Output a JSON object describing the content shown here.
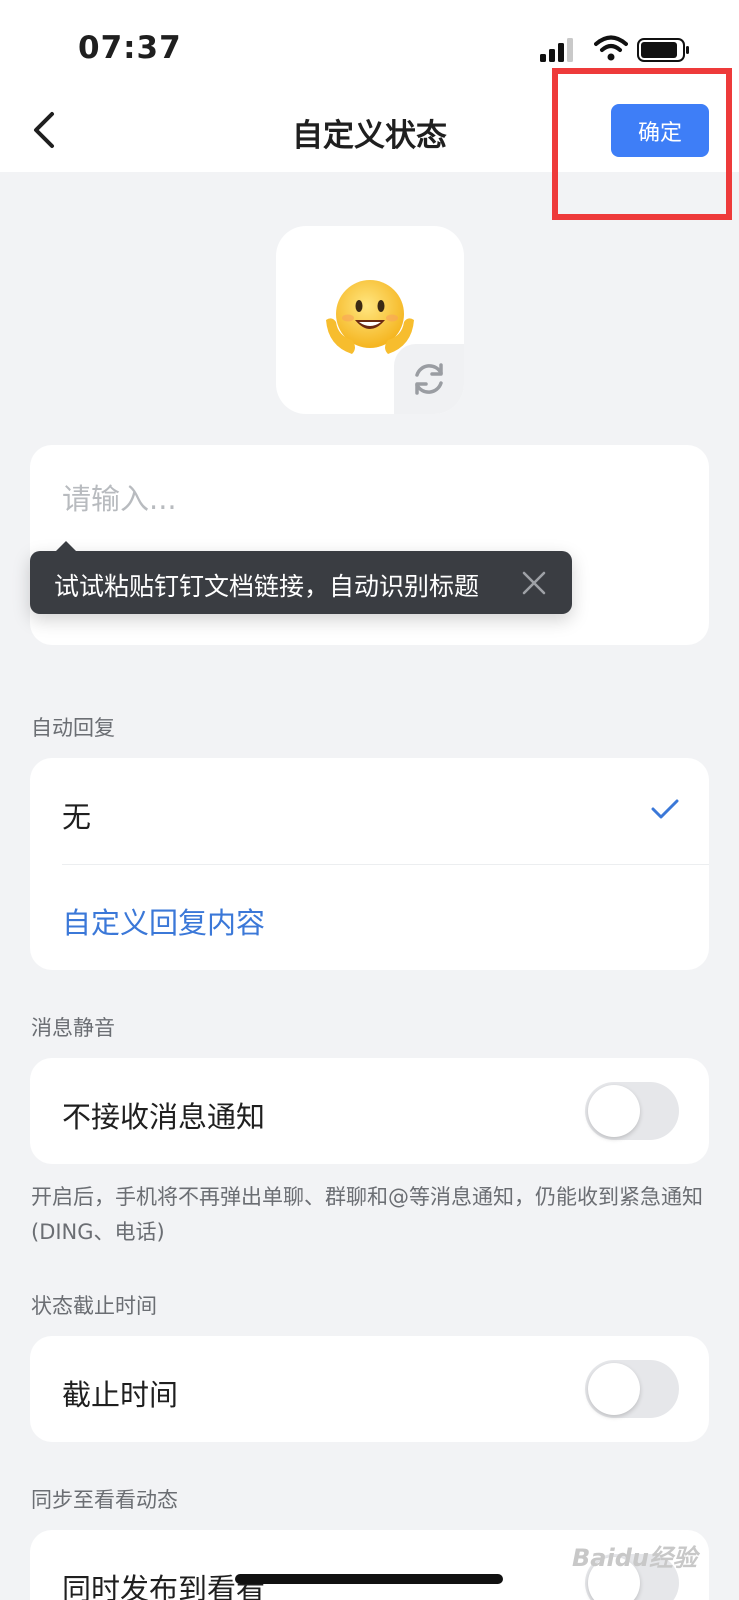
{
  "status_bar": {
    "time": "07:37"
  },
  "nav": {
    "title": "自定义状态",
    "confirm_label": "确定"
  },
  "emoji": {
    "icon": "hugging-face-emoji",
    "refresh_icon": "refresh-icon"
  },
  "input": {
    "placeholder": "请输入...",
    "value": ""
  },
  "tooltip": {
    "text": "试试粘贴钉钉文档链接，自动识别标题"
  },
  "auto_reply": {
    "section_label": "自动回复",
    "options": [
      {
        "label": "无",
        "selected": true
      },
      {
        "label": "自定义回复内容",
        "selected": false
      }
    ]
  },
  "mute": {
    "section_label": "消息静音",
    "row_label": "不接收消息通知",
    "enabled": false,
    "helper": "开启后，手机将不再弹出单聊、群聊和@等消息通知，仍能收到紧急通知(DING、电话)"
  },
  "deadline": {
    "section_label": "状态截止时间",
    "row_label": "截止时间",
    "enabled": false
  },
  "sync": {
    "section_label": "同步至看看动态",
    "row_label": "同时发布到看看",
    "enabled": false
  },
  "watermark": "Baidu经验",
  "colors": {
    "accent": "#3e7ef7",
    "link": "#3b78d8",
    "highlight": "#ee3a3a",
    "background": "#f2f3f5"
  }
}
